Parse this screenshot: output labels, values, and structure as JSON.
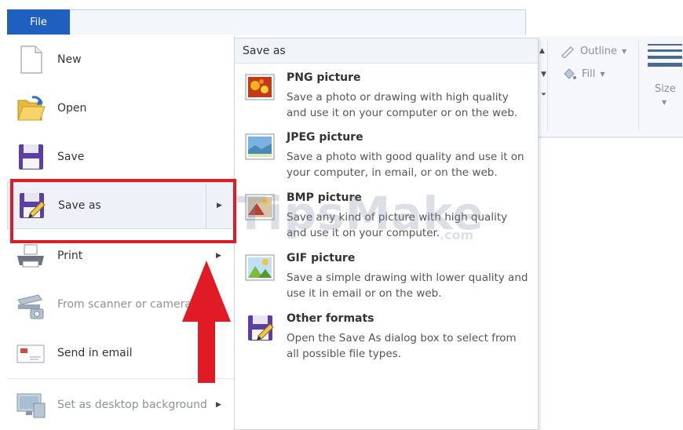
{
  "file_tab": "File",
  "ribbon": {
    "outline_label": "Outline",
    "fill_label": "Fill",
    "size_label": "Size"
  },
  "left_menu": [
    {
      "key": "new",
      "label": "New",
      "disabled": false,
      "has_arrow": false,
      "icon": "new-document-icon"
    },
    {
      "key": "open",
      "label": "Open",
      "disabled": false,
      "has_arrow": false,
      "icon": "open-folder-icon"
    },
    {
      "key": "save",
      "label": "Save",
      "disabled": false,
      "has_arrow": false,
      "icon": "save-floppy-icon"
    },
    {
      "key": "save-as",
      "label": "Save as",
      "disabled": false,
      "has_arrow": true,
      "selected": true,
      "icon": "save-as-icon"
    },
    {
      "key": "print",
      "label": "Print",
      "disabled": false,
      "has_arrow": true,
      "icon": "printer-icon"
    },
    {
      "key": "scanner",
      "label": "From scanner or camera",
      "disabled": true,
      "has_arrow": false,
      "icon": "scanner-icon"
    },
    {
      "key": "email",
      "label": "Send in email",
      "disabled": false,
      "has_arrow": false,
      "icon": "email-icon"
    },
    {
      "key": "desktop-bg",
      "label": "Set as desktop background",
      "disabled": true,
      "has_arrow": true,
      "icon": "desktop-icon"
    }
  ],
  "submenu": {
    "header": "Save as",
    "items": [
      {
        "key": "png",
        "title": "PNG picture",
        "desc": "Save a photo or drawing with high quality and use it on your computer or on the web.",
        "icon": "png-picture-icon"
      },
      {
        "key": "jpeg",
        "title": "JPEG picture",
        "desc": "Save a photo with good quality and use it on your computer, in email, or on the web.",
        "icon": "jpeg-picture-icon"
      },
      {
        "key": "bmp",
        "title": "BMP picture",
        "desc": "Save any kind of picture with high quality and use it on your computer.",
        "icon": "bmp-picture-icon"
      },
      {
        "key": "gif",
        "title": "GIF picture",
        "desc": "Save a simple drawing with lower quality and use it in email or on the web.",
        "icon": "gif-picture-icon"
      },
      {
        "key": "other",
        "title": "Other formats",
        "desc": "Open the Save As dialog box to select from all possible file types.",
        "icon": "other-formats-icon"
      }
    ]
  },
  "watermark": {
    "text": "TipsMake",
    "suffix": ".com"
  },
  "colors": {
    "file_tab": "#1f5fbf",
    "highlight": "#e01b26"
  }
}
